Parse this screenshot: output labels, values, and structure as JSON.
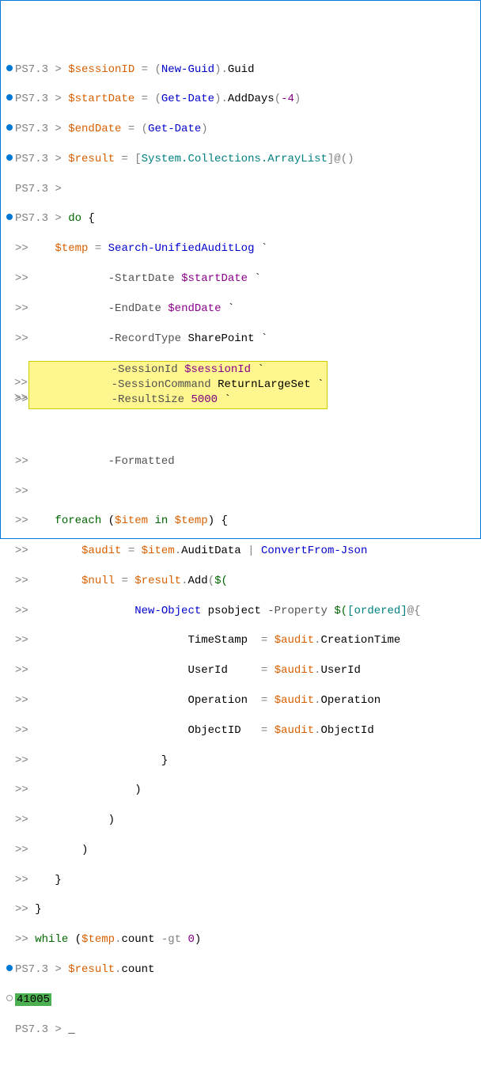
{
  "prompt": "PS7.3 >",
  "cont": ">>",
  "lines": {
    "l01": {
      "prompt": "PS7.3 >",
      "var": "$sessionID",
      "op": " = (",
      "cmd": "New-Guid",
      "op2": ").",
      "prop": "Guid"
    },
    "l02": {
      "prompt": "PS7.3 >",
      "var": "$startDate",
      "op": " = (",
      "cmd": "Get-Date",
      "op2": ").",
      "method": "AddDays",
      "p": "(",
      "num": "-4",
      "p2": ")"
    },
    "l03": {
      "prompt": "PS7.3 >",
      "var": "$endDate",
      "op": " = (",
      "cmd": "Get-Date",
      "op2": ")"
    },
    "l04": {
      "prompt": "PS7.3 >",
      "var": "$result",
      "op": " = [",
      "type": "System.Collections.ArrayList",
      "op2": "]@()"
    },
    "l05": {
      "prompt": "PS7.3 >"
    },
    "l06": {
      "prompt": "PS7.3 >",
      "kw": "do",
      "b": " {"
    },
    "l07": {
      "cont": ">>",
      "pad": "    ",
      "var": "$temp",
      "op": " = ",
      "cmd": "Search-UnifiedAuditLog",
      "bt": " `"
    },
    "l08": {
      "cont": ">>",
      "pad": "            ",
      "param": "-StartDate",
      "sp": " ",
      "paramv": "$startDate",
      "bt": " `"
    },
    "l09": {
      "cont": ">>",
      "pad": "            ",
      "param": "-EndDate",
      "sp": " ",
      "paramv": "$endDate",
      "bt": " `"
    },
    "l10": {
      "cont": ">>",
      "pad": "            ",
      "param": "-RecordType",
      "sp": " ",
      "rt": "SharePoint",
      "bt": " `"
    },
    "l11": {
      "cont": ">>",
      "pad": "            ",
      "param": "-SessionId",
      "sp": " ",
      "paramv": "$sessionId",
      "bt": " `"
    },
    "l12": {
      "cont": ">>",
      "pad": "            ",
      "param": "-SessionCommand",
      "sp": " ",
      "rt": "ReturnLargeSet",
      "bt": " `"
    },
    "l13": {
      "cont": ">>",
      "pad": "            ",
      "param": "-ResultSize",
      "sp": " ",
      "num": "5000",
      "bt": " `"
    },
    "l14": {
      "cont": ">>",
      "pad": "            ",
      "param": "-Formatted"
    },
    "l15": {
      "cont": ">>"
    },
    "l16": {
      "cont": ">>",
      "pad": "    ",
      "kw": "foreach",
      "p": " (",
      "var": "$item",
      "in": " in ",
      "var2": "$temp",
      "p2": ") {"
    },
    "l17": {
      "cont": ">>",
      "pad": "        ",
      "var": "$audit",
      "op": " = ",
      "var2": "$item",
      "op2": ".",
      "prop": "AuditData",
      "pipe": " | ",
      "cmd": "ConvertFrom-Json"
    },
    "l18": {
      "cont": ">>",
      "pad": "        ",
      "var": "$null",
      "op": " = ",
      "var2": "$result",
      "op2": ".",
      "method": "Add",
      "p": "(",
      "sub": "$("
    },
    "l19": {
      "cont": ">>",
      "pad": "                ",
      "cmd": "New-Object",
      "sp": " ",
      "rt": "psobject",
      "sp2": " ",
      "param": "-Property",
      "sp3": " ",
      "sub": "$(",
      "ord": "[ordered]",
      "at": "@{"
    },
    "l20": {
      "cont": ">>",
      "pad": "                        ",
      "key": "TimeStamp",
      "eq": "  = ",
      "var": "$audit",
      "op": ".",
      "prop": "CreationTime"
    },
    "l21": {
      "cont": ">>",
      "pad": "                        ",
      "key": "UserId",
      "eq": "     = ",
      "var": "$audit",
      "op": ".",
      "prop": "UserId"
    },
    "l22": {
      "cont": ">>",
      "pad": "                        ",
      "key": "Operation",
      "eq": "  = ",
      "var": "$audit",
      "op": ".",
      "prop": "Operation"
    },
    "l23": {
      "cont": ">>",
      "pad": "                        ",
      "key": "ObjectID",
      "eq": "   = ",
      "var": "$audit",
      "op": ".",
      "prop": "ObjectId"
    },
    "l24": {
      "cont": ">>",
      "pad": "                    ",
      "text": "}"
    },
    "l25": {
      "cont": ">>",
      "pad": "                ",
      "text": ")"
    },
    "l26": {
      "cont": ">>",
      "pad": "            ",
      "text": ")"
    },
    "l27": {
      "cont": ">>",
      "pad": "        ",
      "text": ")"
    },
    "l28": {
      "cont": ">>",
      "pad": "    ",
      "text": "}"
    },
    "l29": {
      "cont": ">>",
      "text": "}"
    },
    "l30": {
      "cont": ">>",
      "kw": "while",
      "p": " (",
      "var": "$temp",
      "op": ".",
      "prop": "count",
      "sp": " ",
      "opkw": "-gt",
      "sp2": " ",
      "num": "0",
      "p2": ")"
    },
    "l31": {
      "prompt": "PS7.3 >",
      "var": "$result",
      "op": ".",
      "prop": "count"
    },
    "l32": {
      "output": "41005"
    },
    "l33": {
      "prompt": "PS7.3 >",
      "cursor": " _"
    }
  }
}
